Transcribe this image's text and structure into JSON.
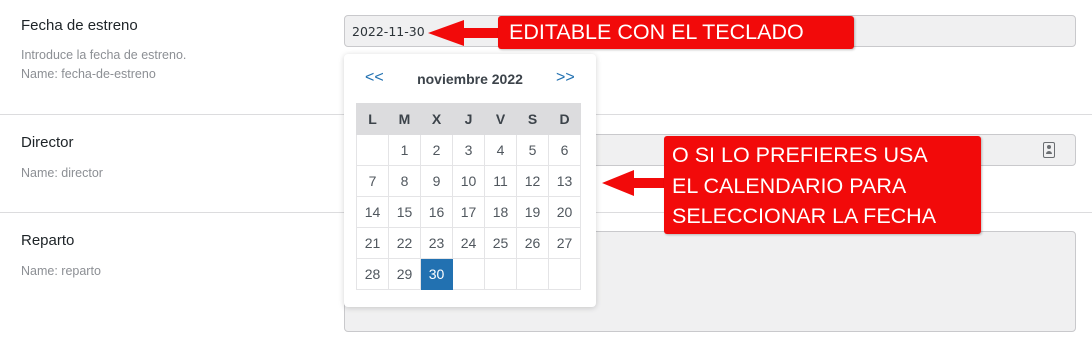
{
  "fields": {
    "release_date": {
      "label": "Fecha de estreno",
      "description": "Introduce la fecha de estreno.",
      "name_note": "Name: fecha-de-estreno",
      "value": "2022-11-30"
    },
    "director": {
      "label": "Director",
      "name_note": "Name: director",
      "value": ""
    },
    "cast": {
      "label": "Reparto",
      "name_note": "Name: reparto",
      "value": ""
    }
  },
  "calendar": {
    "prev_label": "<<",
    "next_label": ">>",
    "month_title": "noviembre 2022",
    "weekdays": [
      "L",
      "M",
      "X",
      "J",
      "V",
      "S",
      "D"
    ],
    "first_weekday_offset": 1,
    "days_in_month": 30,
    "selected_day": 30
  },
  "annotations": {
    "keyboard_callout": "EDITABLE CON EL TECLADO",
    "calendar_callout_lines": [
      "O SI LO PREFIERES USA",
      "EL CALENDARIO PARA",
      "SELECCIONAR LA FECHA"
    ],
    "color": "#f20a0a"
  },
  "icons": {
    "director_field_icon": "contact-card-icon"
  },
  "colors": {
    "selected_day": "#2271b1",
    "weekday_header": "#dcdcde",
    "field_background": "#f0f0f1"
  }
}
